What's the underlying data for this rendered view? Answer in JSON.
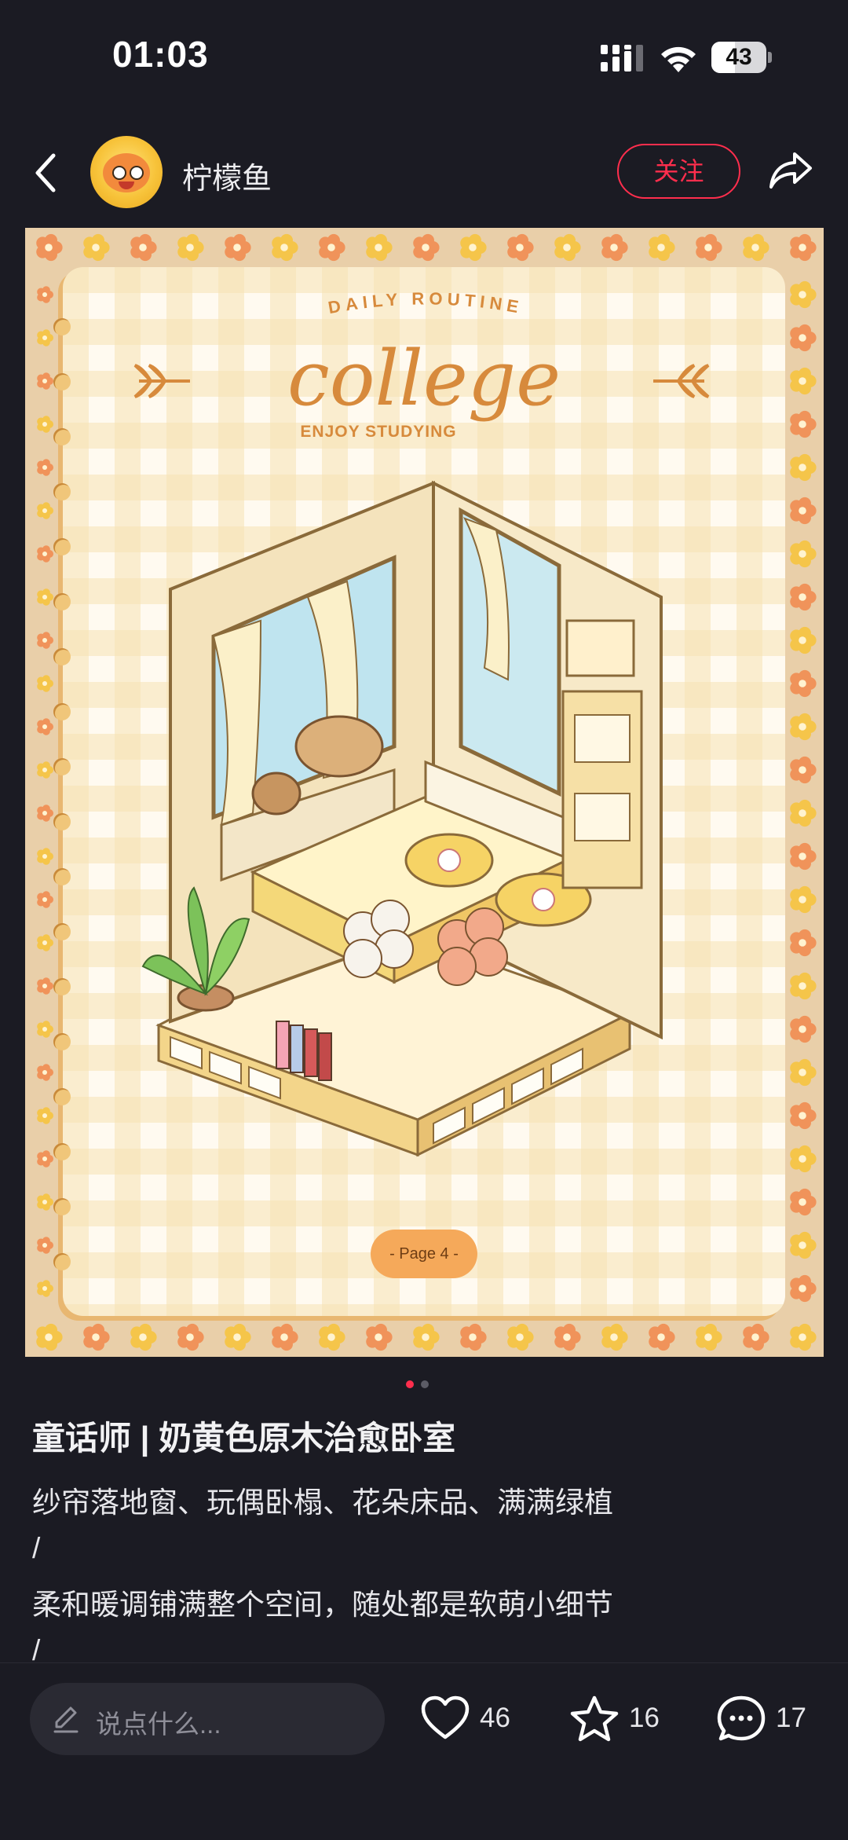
{
  "status_bar": {
    "time": "01:03",
    "battery": "43",
    "battery_level": 0.43
  },
  "header": {
    "username": "柠檬鱼",
    "follow_label": "关注"
  },
  "image": {
    "arc_text": "DAILY ROUTINE",
    "script_title": "college",
    "subtitle": "ENJOY STUDYING",
    "page_label": "- Page 4 -"
  },
  "carousel": {
    "total": 2,
    "active": 1
  },
  "post": {
    "title": "童话师 | 奶黄色原木治愈卧室",
    "lines": [
      "纱帘落地窗、玩偶卧榻、花朵床品、满满绿植",
      "/",
      "柔和暖调铺满整个空间，随处都是软萌小细节",
      "/"
    ]
  },
  "bottom_bar": {
    "comment_placeholder": "说点什么...",
    "likes": "46",
    "favorites": "16",
    "comments": "17"
  },
  "colors": {
    "accent": "#ff2e4d",
    "background": "#1b1b23",
    "card": "#fffaf0",
    "frame": "#e9cfa9"
  }
}
